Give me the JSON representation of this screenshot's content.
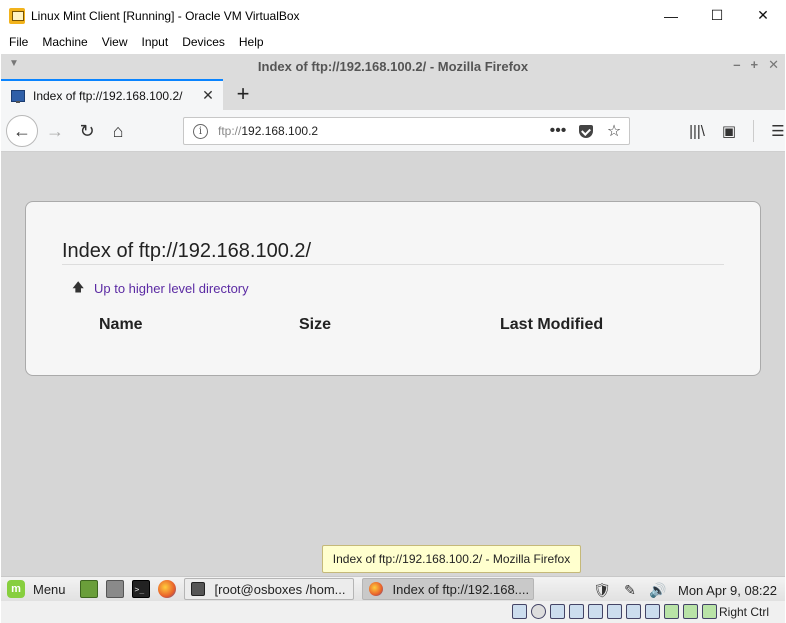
{
  "vbox": {
    "window_title": "Linux Mint Client [Running] - Oracle VM VirtualBox",
    "controls": {
      "minimize": "—",
      "maximize": "☐",
      "close": "✕"
    },
    "menu": [
      "File",
      "Machine",
      "View",
      "Input",
      "Devices",
      "Help"
    ],
    "host_key": "Right Ctrl"
  },
  "firefox": {
    "window_title": "Index of ftp://192.168.100.2/ - Mozilla Firefox",
    "title_controls": {
      "menu": "▼",
      "minimize": "–",
      "maximize": "+",
      "close": "✕"
    },
    "tab": {
      "label": "Index of ftp://192.168.100.2/",
      "close": "✕"
    },
    "new_tab": "+",
    "url": {
      "info": "i",
      "scheme": "ftp://",
      "host": "192.168.100.2"
    },
    "nav": {
      "back": "←",
      "forward": "→",
      "reload": "↻",
      "home": "⌂"
    },
    "url_actions": {
      "more": "•••",
      "bookmark": "☆"
    },
    "toolbar": {
      "library": "|||\\",
      "sidebar": "▣",
      "menu": "☰"
    }
  },
  "page": {
    "heading": "Index of ftp://192.168.100.2/",
    "up_arrow": "🡅",
    "up_link": "Up to higher level directory",
    "columns": [
      "Name",
      "Size",
      "Last Modified"
    ]
  },
  "tooltip": "Index of ftp://192.168.100.2/ - Mozilla Firefox",
  "taskbar": {
    "menu_label": "Menu",
    "term_glyph": ">_",
    "tasks": [
      {
        "label": "[root@osboxes /hom...",
        "active": false
      },
      {
        "label": "Index of ftp://192.168....",
        "active": true
      }
    ],
    "tray": {
      "shield": "🛡",
      "pen": "✎",
      "volume": "🔊"
    },
    "clock": "Mon Apr  9, 08:22"
  }
}
